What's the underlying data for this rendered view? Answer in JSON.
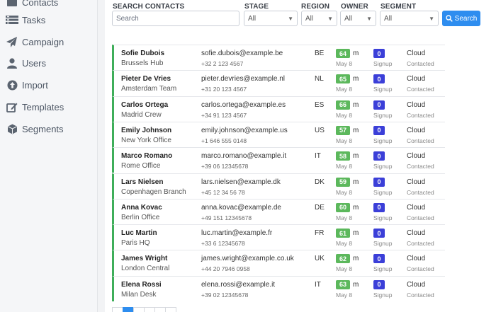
{
  "sidebar": {
    "items": [
      {
        "label": "Contacts",
        "icon": "contacts-icon"
      },
      {
        "label": "Tasks",
        "icon": "tasks-icon"
      },
      {
        "label": "Campaign",
        "icon": "paper-plane-icon"
      },
      {
        "label": "Users",
        "icon": "user-icon"
      },
      {
        "label": "Import",
        "icon": "upload-icon"
      },
      {
        "label": "Templates",
        "icon": "edit-icon"
      },
      {
        "label": "Segments",
        "icon": "cube-icon"
      }
    ]
  },
  "filters": {
    "search_label": "SEARCH CONTACTS",
    "search_placeholder": "Search",
    "stage_label": "STAGE",
    "stage_value": "All",
    "region_label": "REGION",
    "region_value": "All",
    "owner_label": "OWNER",
    "owner_value": "All",
    "segment_label": "SEGMENT",
    "segment_value": "All",
    "search_button": "Search"
  },
  "contacts": [
    {
      "name": "Sofie Dubois",
      "team": "Brussels Hub",
      "email": "sofie.dubois@example.be",
      "phone": "+32 2 123 4567",
      "country": "BE",
      "score": "64",
      "unit": "m",
      "date": "May 8",
      "count": "0",
      "stage": "Signup",
      "segment": "Cloud",
      "status": "Contacted"
    },
    {
      "name": "Pieter De Vries",
      "team": "Amsterdam Team",
      "email": "pieter.devries@example.nl",
      "phone": "+31 20 123 4567",
      "country": "NL",
      "score": "65",
      "unit": "m",
      "date": "May 8",
      "count": "0",
      "stage": "Signup",
      "segment": "Cloud",
      "status": "Contacted"
    },
    {
      "name": "Carlos Ortega",
      "team": "Madrid Crew",
      "email": "carlos.ortega@example.es",
      "phone": "+34 91 123 4567",
      "country": "ES",
      "score": "66",
      "unit": "m",
      "date": "May 8",
      "count": "0",
      "stage": "Signup",
      "segment": "Cloud",
      "status": "Contacted"
    },
    {
      "name": "Emily Johnson",
      "team": "New York Office",
      "email": "emily.johnson@example.us",
      "phone": "+1 646 555 0148",
      "country": "US",
      "score": "57",
      "unit": "m",
      "date": "May 8",
      "count": "0",
      "stage": "Signup",
      "segment": "Cloud",
      "status": "Contacted"
    },
    {
      "name": "Marco Romano",
      "team": "Rome Office",
      "email": "marco.romano@example.it",
      "phone": "+39 06 12345678",
      "country": "IT",
      "score": "58",
      "unit": "m",
      "date": "May 8",
      "count": "0",
      "stage": "Signup",
      "segment": "Cloud",
      "status": "Contacted"
    },
    {
      "name": "Lars Nielsen",
      "team": "Copenhagen Branch",
      "email": "lars.nielsen@example.dk",
      "phone": "+45 12 34 56 78",
      "country": "DK",
      "score": "59",
      "unit": "m",
      "date": "May 8",
      "count": "0",
      "stage": "Signup",
      "segment": "Cloud",
      "status": "Contacted"
    },
    {
      "name": "Anna Kovac",
      "team": "Berlin Office",
      "email": "anna.kovac@example.de",
      "phone": "+49 151 12345678",
      "country": "DE",
      "score": "60",
      "unit": "m",
      "date": "May 8",
      "count": "0",
      "stage": "Signup",
      "segment": "Cloud",
      "status": "Contacted"
    },
    {
      "name": "Luc Martin",
      "team": "Paris HQ",
      "email": "luc.martin@example.fr",
      "phone": "+33 6 12345678",
      "country": "FR",
      "score": "61",
      "unit": "m",
      "date": "May 8",
      "count": "0",
      "stage": "Signup",
      "segment": "Cloud",
      "status": "Contacted"
    },
    {
      "name": "James Wright",
      "team": "London Central",
      "email": "james.wright@example.co.uk",
      "phone": "+44 20 7946 0958",
      "country": "UK",
      "score": "62",
      "unit": "m",
      "date": "May 8",
      "count": "0",
      "stage": "Signup",
      "segment": "Cloud",
      "status": "Contacted"
    },
    {
      "name": "Elena Rossi",
      "team": "Milan Desk",
      "email": "elena.rossi@example.it",
      "phone": "+39 02 12345678",
      "country": "IT",
      "score": "63",
      "unit": "m",
      "date": "May 8",
      "count": "0",
      "stage": "Signup",
      "segment": "Cloud",
      "status": "Contacted"
    }
  ],
  "colors": {
    "accent": "#2e8def",
    "row_marker": "#3fae5a",
    "score_badge": "#5cb85c",
    "count_badge": "#3b3fd8"
  }
}
